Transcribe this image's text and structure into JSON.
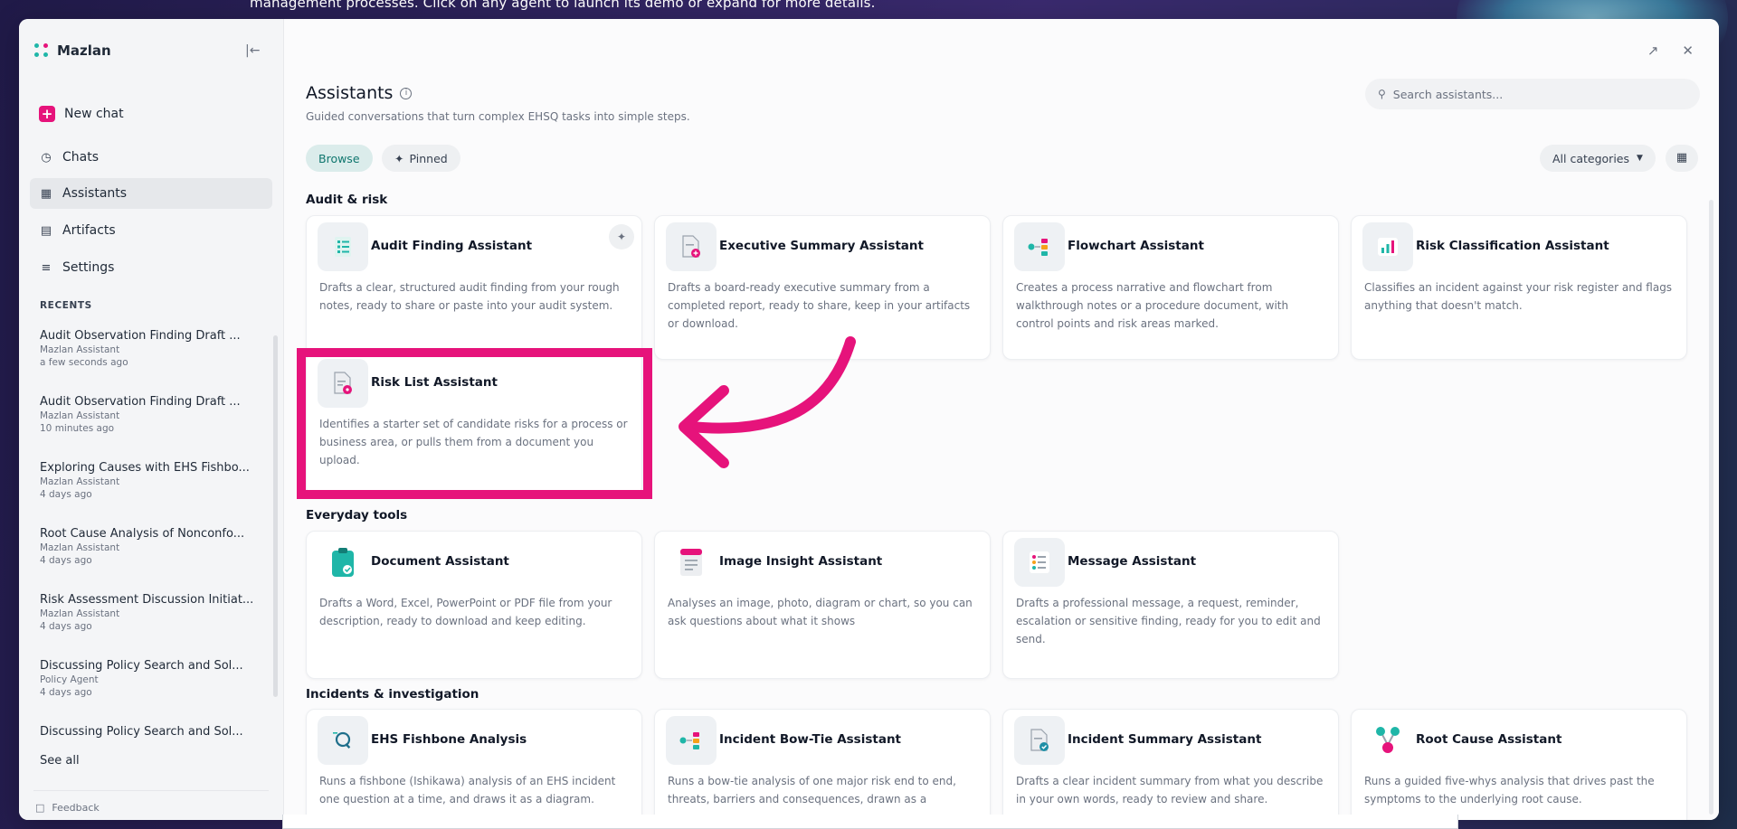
{
  "background": {
    "banner_text": "management processes. Click on any agent to launch its demo or expand for more details."
  },
  "sidebar": {
    "brand": "Mazlan",
    "new_chat": "New chat",
    "nav": [
      {
        "label": "Chats",
        "icon": "chat-icon"
      },
      {
        "label": "Assistants",
        "icon": "grid-icon",
        "active": true
      },
      {
        "label": "Artifacts",
        "icon": "document-icon"
      },
      {
        "label": "Settings",
        "icon": "sliders-icon"
      }
    ],
    "recents_heading": "RECENTS",
    "recents": [
      {
        "title": "Audit Observation Finding Draft ...",
        "agent": "Mazlan Assistant",
        "time": "a few seconds ago"
      },
      {
        "title": "Audit Observation Finding Draft ...",
        "agent": "Mazlan Assistant",
        "time": "10 minutes ago"
      },
      {
        "title": "Exploring Causes with EHS Fishbo...",
        "agent": "Mazlan Assistant",
        "time": "4 days ago"
      },
      {
        "title": "Root Cause Analysis of Nonconfo...",
        "agent": "Mazlan Assistant",
        "time": "4 days ago"
      },
      {
        "title": "Risk Assessment Discussion Initiat...",
        "agent": "Mazlan Assistant",
        "time": "4 days ago"
      },
      {
        "title": "Discussing Policy Search and Sol...",
        "agent": "Policy Agent",
        "time": "4 days ago"
      },
      {
        "title": "Discussing Policy Search and Sol..."
      }
    ],
    "see_all": "See all",
    "feedback": "Feedback"
  },
  "main": {
    "title": "Assistants",
    "subtitle": "Guided conversations that turn complex EHSQ tasks into simple steps.",
    "search_placeholder": "Search assistants...",
    "tabs": {
      "browse": "Browse",
      "pinned": "Pinned"
    },
    "category_select": "All categories",
    "sections": [
      {
        "heading": "Audit & risk",
        "cards": [
          {
            "title": "Audit Finding Assistant",
            "desc": "Drafts a clear, structured audit finding from your rough notes, ready to share or paste into your audit system.",
            "icon": "checklist-icon"
          },
          {
            "title": "Executive Summary Assistant",
            "desc": "Drafts a board-ready executive summary from a completed report, ready to share, keep in your artifacts or download.",
            "icon": "file-plus-icon"
          },
          {
            "title": "Flowchart Assistant",
            "desc": "Creates a process narrative and flowchart from walkthrough notes or a procedure document, with control points and risk areas marked.",
            "icon": "flowchart-icon"
          },
          {
            "title": "Risk Classification Assistant",
            "desc": "Classifies an incident against your risk register and flags anything that doesn't match.",
            "icon": "bar-chart-icon"
          },
          {
            "title": "Risk List Assistant",
            "desc": "Identifies a starter set of candidate risks for a process or business area, or pulls them from a document you upload.",
            "icon": "file-alert-icon"
          }
        ]
      },
      {
        "heading": "Everyday tools",
        "cards": [
          {
            "title": "Document Assistant",
            "desc": "Drafts a Word, Excel, PowerPoint or PDF file from your description, ready to download and keep editing.",
            "icon": "clipboard-icon"
          },
          {
            "title": "Image Insight Assistant",
            "desc": "Analyses an image, photo, diagram or chart, so you can ask questions about what it shows",
            "icon": "image-doc-icon"
          },
          {
            "title": "Message Assistant",
            "desc": "Drafts a professional message, a request, reminder, escalation or sensitive finding, ready for you to edit and send.",
            "icon": "message-list-icon"
          }
        ]
      },
      {
        "heading": "Incidents & investigation",
        "cards": [
          {
            "title": "EHS Fishbone Analysis",
            "desc": "Runs a fishbone (Ishikawa) analysis of an EHS incident one question at a time, and draws it as a diagram.",
            "icon": "fishbone-icon"
          },
          {
            "title": "Incident Bow-Tie Assistant",
            "desc": "Runs a bow-tie analysis of one major risk end to end, threats, barriers and consequences, drawn as a",
            "icon": "bowtie-icon"
          },
          {
            "title": "Incident Summary Assistant",
            "desc": "Drafts a clear incident summary from what you describe in your own words, ready to review and share.",
            "icon": "file-check-icon"
          },
          {
            "title": "Root Cause Assistant",
            "desc": "Runs a guided five-whys analysis that drives past the symptoms to the underlying root cause.",
            "icon": "root-node-icon"
          }
        ]
      }
    ]
  },
  "colors": {
    "accent": "#e6137b",
    "teal": "#1fb6a8",
    "annotation": "#e6137b"
  }
}
